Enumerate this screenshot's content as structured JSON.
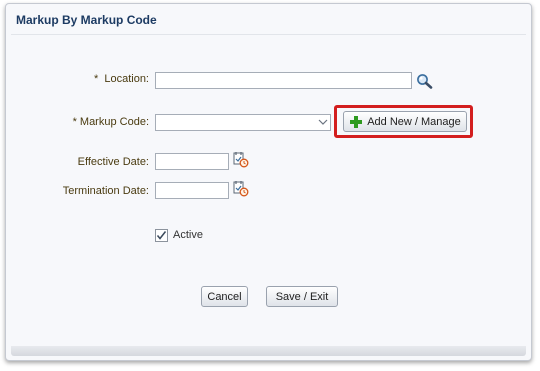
{
  "dialog": {
    "title": "Markup By Markup Code"
  },
  "form": {
    "location": {
      "required_mark": "*",
      "label": "Location:",
      "value": ""
    },
    "markup_code": {
      "required_mark": "*",
      "label": "Markup Code:",
      "value": ""
    },
    "add_new_button": {
      "label": "Add New / Manage"
    },
    "effective_date": {
      "label": "Effective Date:",
      "value": ""
    },
    "termination_date": {
      "label": "Termination Date:",
      "value": ""
    },
    "active": {
      "label": "Active",
      "checked": true
    }
  },
  "buttons": {
    "cancel": "Cancel",
    "save_exit": "Save / Exit"
  },
  "colors": {
    "highlight": "#d31e1e",
    "title": "#1d3b63",
    "label": "#4a3b10",
    "plus_icon": "#2e9a1f"
  },
  "icons": [
    "search-icon",
    "chevron-down-icon",
    "plus-icon",
    "calendar-icon",
    "checkmark-icon"
  ]
}
